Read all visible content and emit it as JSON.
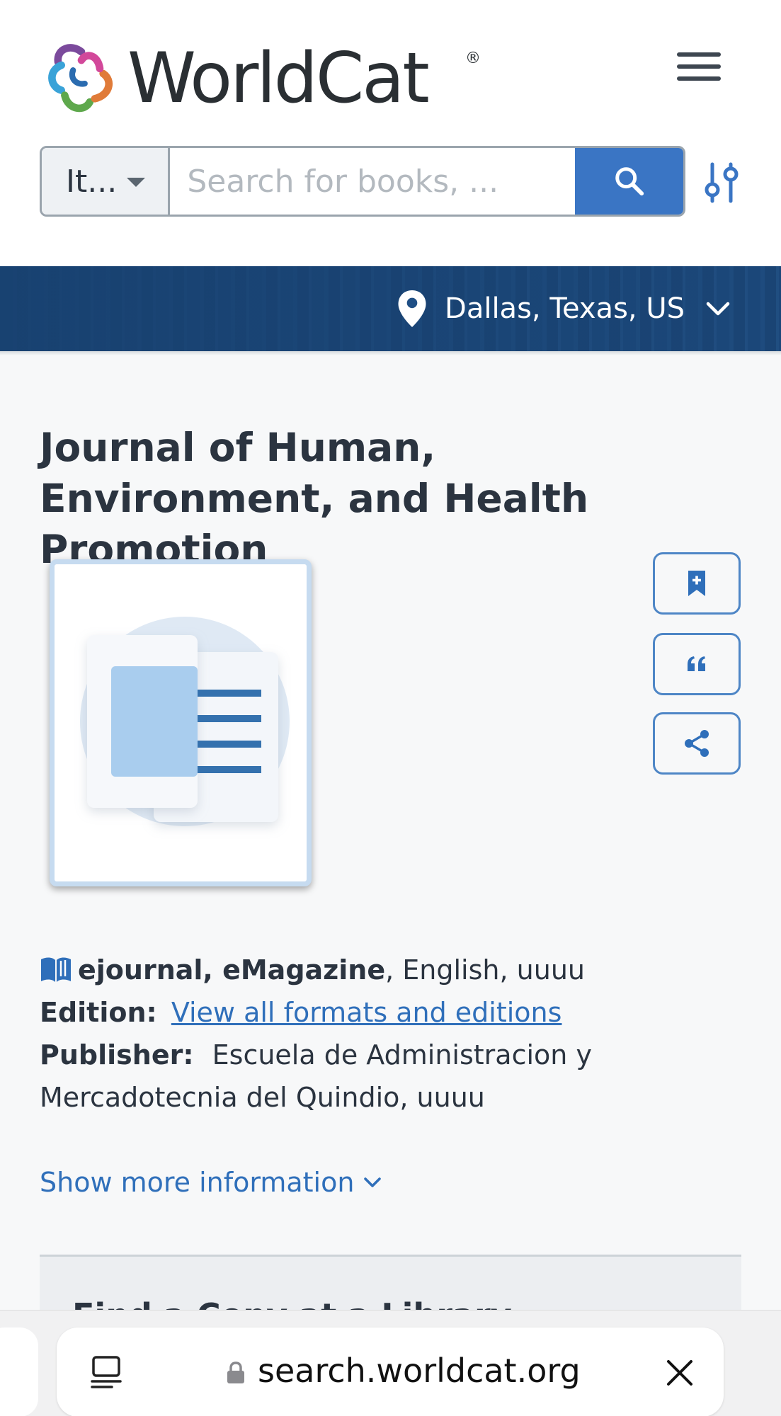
{
  "header": {
    "logo_text": "WorldCat",
    "logo_reg": "®",
    "menu_icon": "hamburger-menu-icon"
  },
  "search": {
    "type_label": "It...",
    "placeholder": "Search for books, ...",
    "search_icon": "magnifier-icon",
    "filters_icon": "sliders-icon"
  },
  "location": {
    "text": "Dallas, Texas, US",
    "pin_icon": "map-pin-icon",
    "chevron_icon": "chevron-down-icon"
  },
  "record": {
    "title": "Journal of Human, Environment, and Health Promotion",
    "format_bold": "ejournal, eMagazine",
    "format_rest": ", English, uuuu",
    "edition_label": "Edition:",
    "edition_link": "View all formats and editions",
    "publisher_label": "Publisher:",
    "publisher_line1": "Escuela de Administracion y",
    "publisher_line2": "Mercadotecnia del Quindio, uuuu",
    "show_more": "Show more information"
  },
  "actions": [
    {
      "name": "save-to-list",
      "icon": "bookmark-plus-icon"
    },
    {
      "name": "cite",
      "icon": "quote-icon"
    },
    {
      "name": "share",
      "icon": "share-icon"
    }
  ],
  "holdings": {
    "title": "Find a Copy at a Library"
  },
  "browser": {
    "url": "search.worldcat.org",
    "colors": {
      "accent": "#3a75c4",
      "link": "#2f6fba",
      "band": "#1f4f85"
    }
  }
}
